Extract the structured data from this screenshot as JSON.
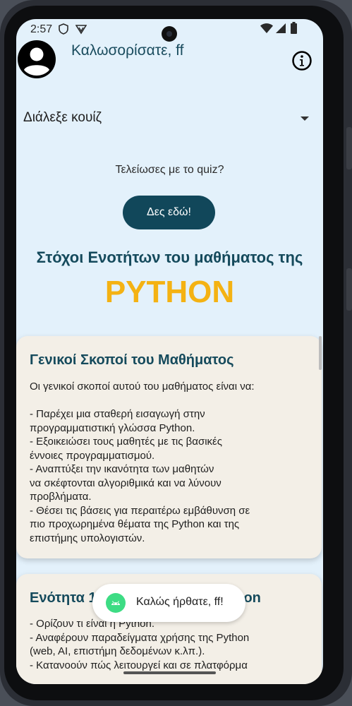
{
  "status_bar": {
    "time": "2:57",
    "icons": [
      "shield-icon",
      "vpn-icon",
      "wifi-icon",
      "signal-icon",
      "battery-icon"
    ]
  },
  "header": {
    "welcome": "Καλωσορίσατε, ff",
    "avatar_icon": "account-circle-icon",
    "info_icon": "info-icon"
  },
  "quiz_dropdown": {
    "selected": "Διάλεξε κουίζ"
  },
  "done_prompt": "Τελείωσες με το quiz?",
  "see_here_button": "Δες εδώ!",
  "goals": {
    "title": "Στόχοι Ενοτήτων του μαθήματος της",
    "subject": "PYTHON"
  },
  "cards": [
    {
      "title": "Γενικοί Σκοποί του Μαθήματος",
      "lines": [
        "Οι γενικοί σκοποί αυτού του μαθήματος είναι να:",
        "",
        "- Παρέχει μια σταθερή εισαγωγή στην",
        "προγραμματιστική γλώσσα Python.",
        "- Εξοικειώσει τους μαθητές με τις βασικές",
        "έννοιες προγραμματισμού.",
        "- Αναπτύξει την ικανότητα των μαθητών",
        "να σκέφτονται αλγοριθμικά και να λύνουν",
        "προβλήματα.",
        "- Θέσει τις βάσεις για περαιτέρω εμβάθυνση σε",
        "πιο προχωρημένα θέματα της Python και της",
        "επιστήμης υπολογιστών."
      ]
    },
    {
      "title": "Ενότητα 1: Εισαγωγή στην Python",
      "lines": [
        "- Ορίζουν τι είναι η Python.",
        "- Αναφέρουν παραδείγματα χρήσης της Python",
        "(web, AI, επιστήμη δεδομένων κ.λπ.).",
        "- Κατανοούν πώς λειτουργεί και σε πλατφόρμα"
      ]
    }
  ],
  "toast": {
    "text": "Καλώς ήρθατε, ff!",
    "icon": "android-icon"
  },
  "colors": {
    "background": "#e3f1fb",
    "primary": "#11475a",
    "accent": "#f4b213",
    "card": "#f3efe7"
  }
}
